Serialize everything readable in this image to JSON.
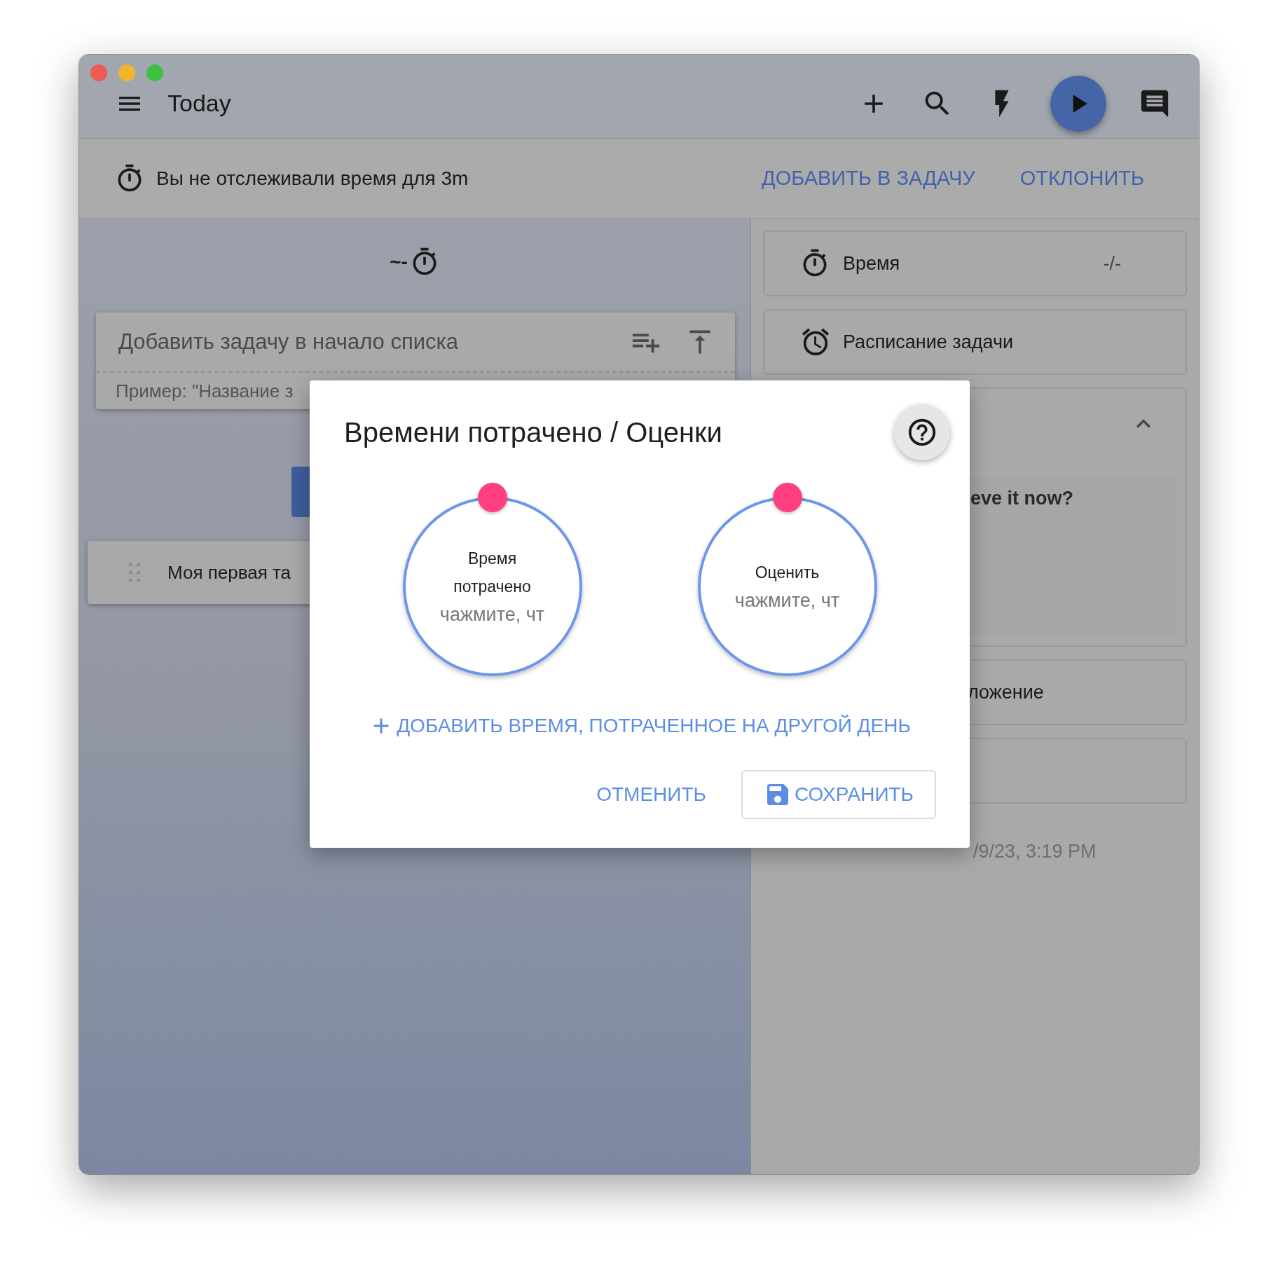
{
  "window": {
    "title": "Today"
  },
  "banner": {
    "message": "Вы не отслеживали время для 3m",
    "actions": [
      "ДОБАВИТЬ В ЗАДАЧУ",
      "ОТКЛОНИТЬ"
    ]
  },
  "task_list": {
    "header": "~-",
    "add_task": {
      "placeholder": "Добавить задачу в начало списка",
      "hint": "Пример: \"Название з"
    },
    "tasks": [
      {
        "title": "Моя первая та"
      }
    ]
  },
  "detail_panel": {
    "items": [
      {
        "kind": "time",
        "label": "Время",
        "value": "-/-"
      },
      {
        "kind": "schedule",
        "label": "Расписание задачи"
      },
      {
        "kind": "expandable",
        "expanded": true,
        "text": "eve it now?"
      },
      {
        "kind": "plain",
        "label": "ложение"
      },
      {
        "kind": "empty"
      }
    ],
    "created": "/9/23, 3:19 PM"
  },
  "dialog": {
    "title": "Времени потрачено / Оценки",
    "dials": [
      {
        "label": "Время потрачено",
        "placeholder": "чажмите, чт"
      },
      {
        "label": "Оценить",
        "placeholder": "чажмите, чт"
      }
    ],
    "add_other_day": "ДОБАВИТЬ ВРЕМЯ, ПОТРАЧЕННОЕ НА ДРУГОЙ ДЕНЬ",
    "buttons": [
      {
        "kind": "text",
        "label": "ОТМЕНИТЬ"
      },
      {
        "kind": "outlined",
        "label": "СОХРАНИТЬ"
      }
    ]
  }
}
